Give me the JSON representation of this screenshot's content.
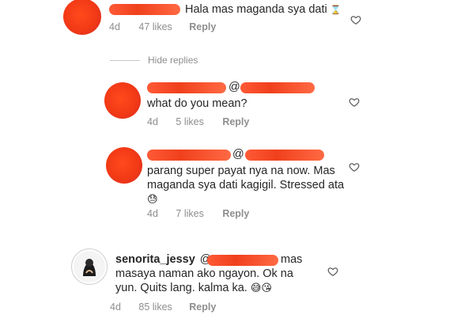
{
  "comments": [
    {
      "text": "Hala mas maganda sya dati",
      "age": "4d",
      "likes": "47 likes",
      "reply_label": "Reply"
    },
    {
      "mention": "@",
      "text": "what do you mean?",
      "age": "4d",
      "likes": "5 likes",
      "reply_label": "Reply"
    },
    {
      "mention": "@",
      "text_line1": "parang super payat nya na now. Mas",
      "text_line2": "maganda sya dati kagigil. Stressed ata",
      "emoji_icon": "crying-face-icon",
      "age": "4d",
      "likes": "7 likes",
      "reply_label": "Reply"
    },
    {
      "username": "senorita_jessy",
      "mention": "@",
      "text_line1_end": "mas",
      "text_line2": "masaya naman ako ngayon. Ok na",
      "text_line3": "yun. Quits lang. kalma ka.",
      "emoji_icons": [
        "laughing-face-icon",
        "kiss-face-icon"
      ],
      "age": "4d",
      "likes": "85 likes",
      "reply_label": "Reply"
    }
  ],
  "hide_replies_label": "Hide replies",
  "colors": {
    "redaction": "#f0401c",
    "muted": "#8e8e8e",
    "text": "#262626"
  }
}
